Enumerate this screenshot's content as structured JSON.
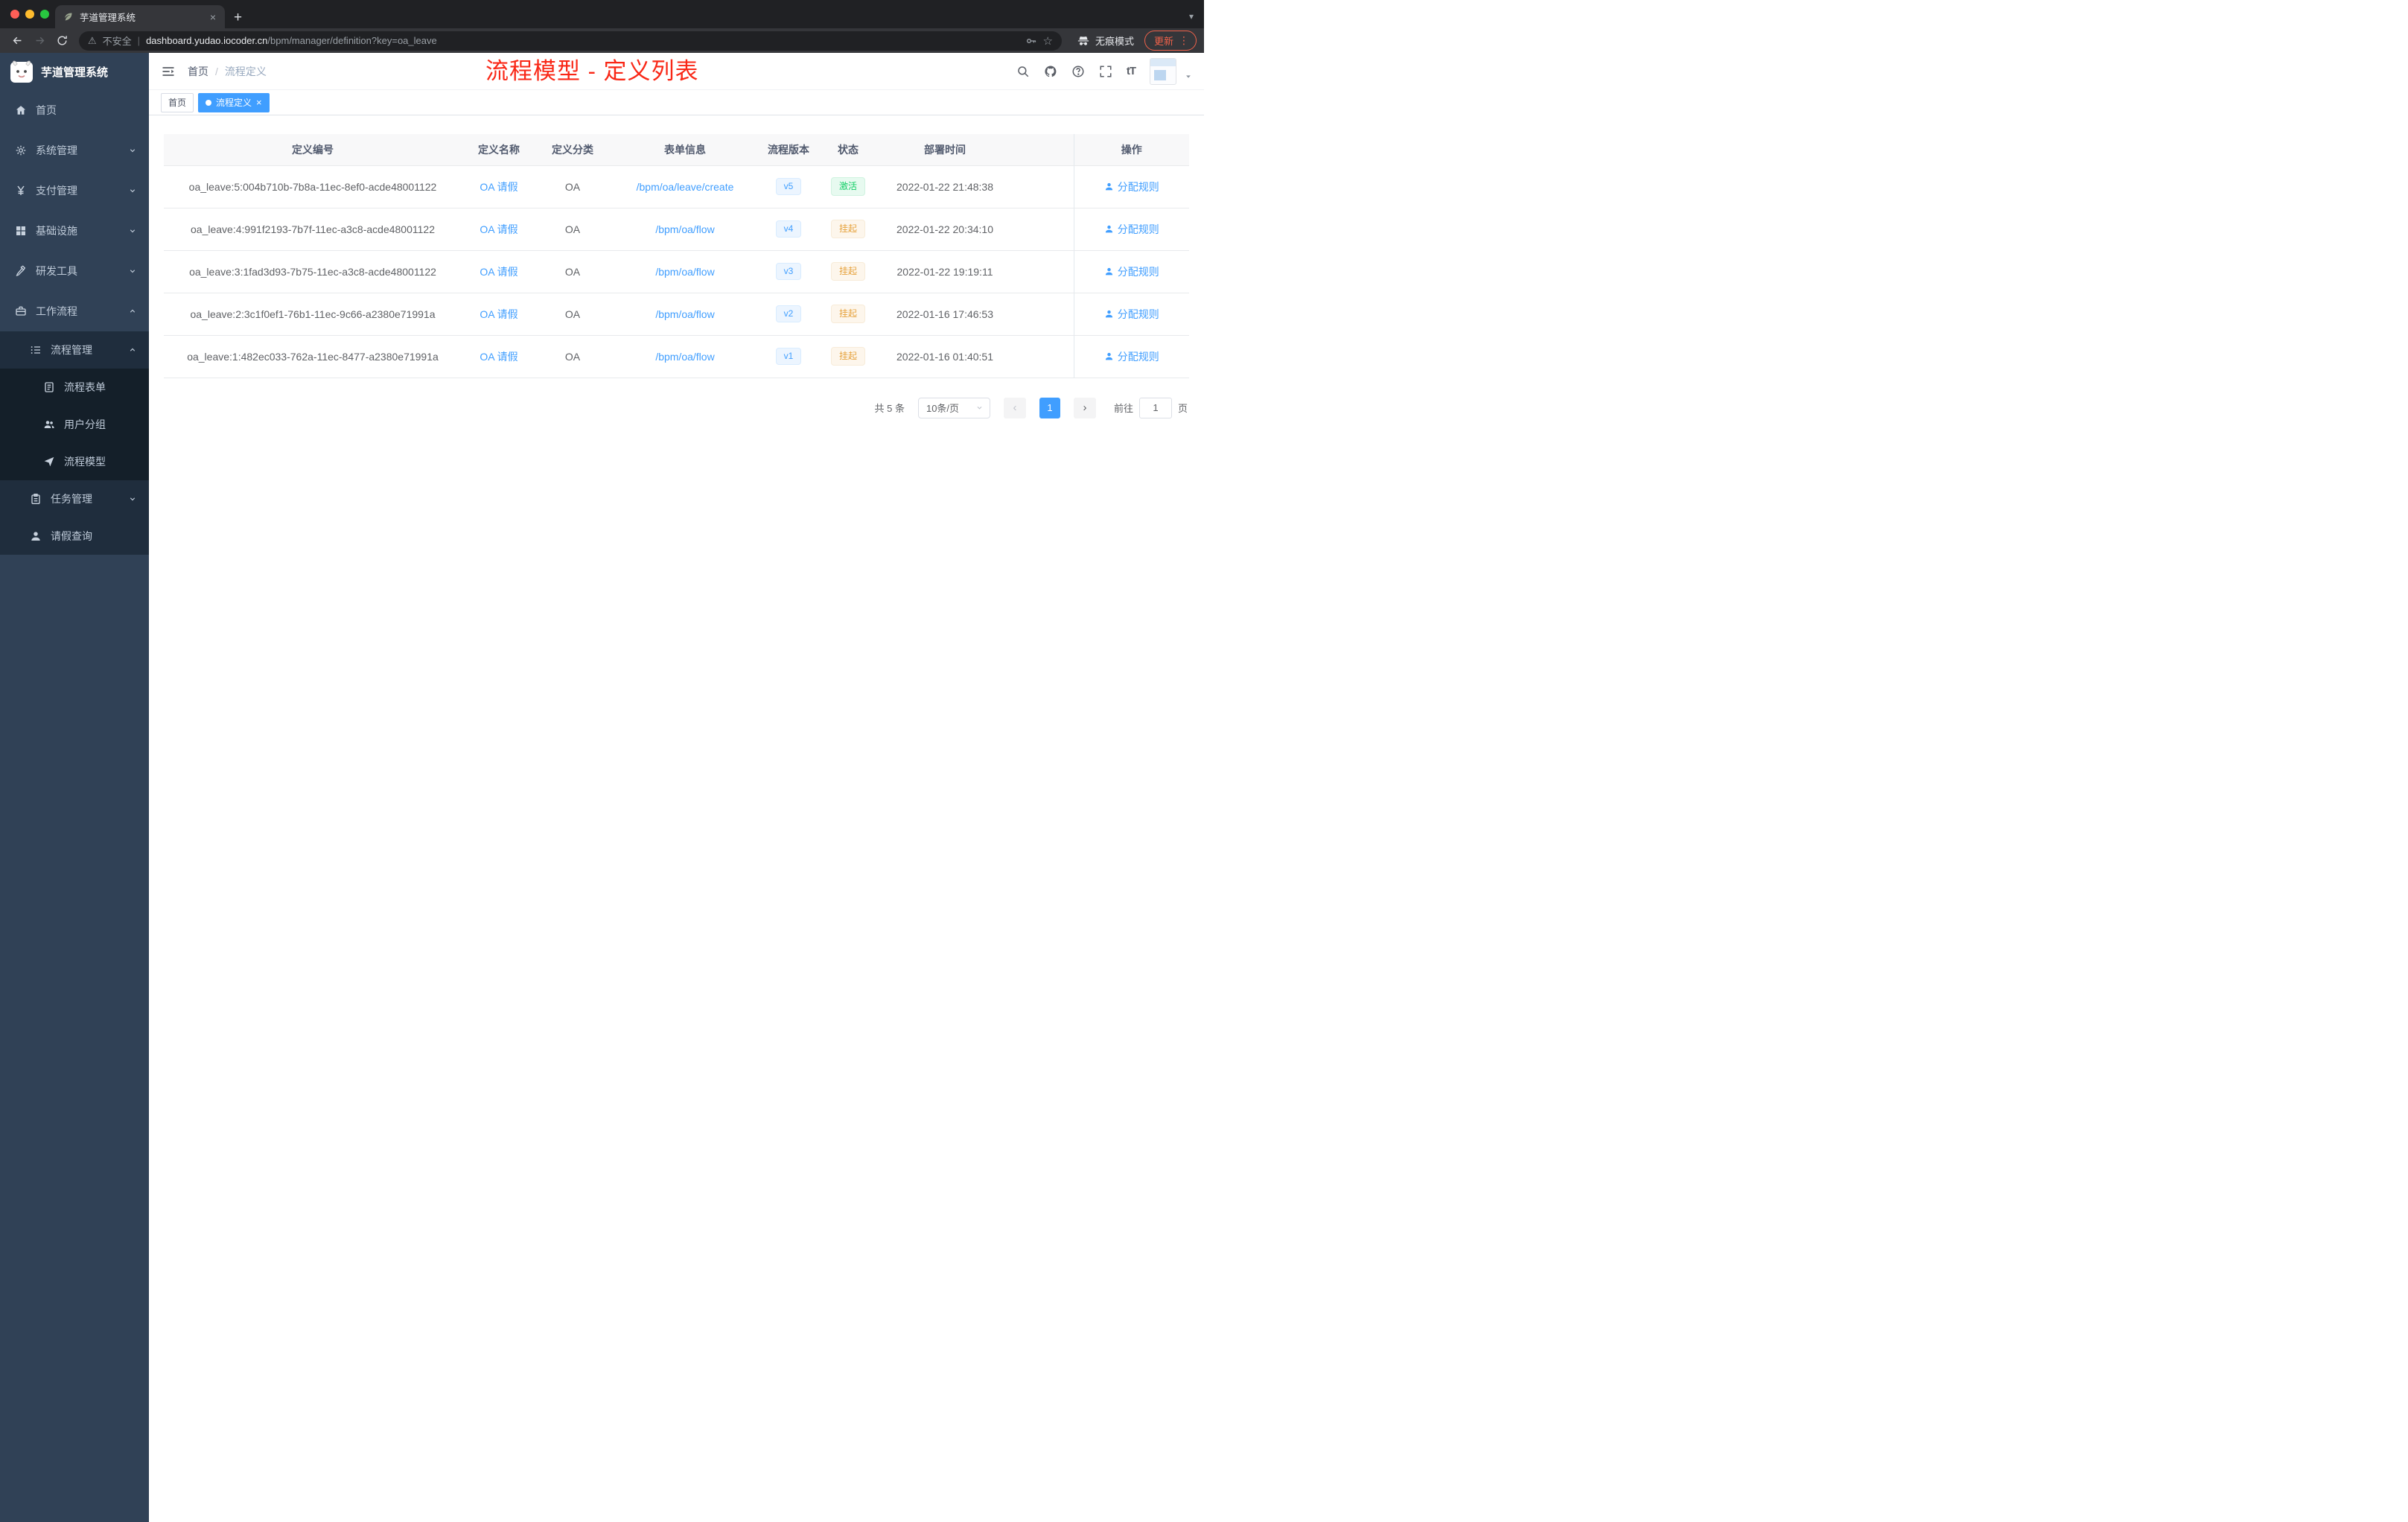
{
  "browser": {
    "tab_title": "芋道管理系统",
    "close_tab": "×",
    "new_tab": "+",
    "security_label": "不安全",
    "url_domain": "dashboard.yudao.iocoder.cn",
    "url_path": "/bpm/manager/definition?key=oa_leave",
    "incognito_label": "无痕模式",
    "update_label": "更新"
  },
  "sidebar": {
    "logo_title": "芋道管理系统",
    "items": [
      {
        "key": "home",
        "label": "首页",
        "icon": "home-icon",
        "level": 1
      },
      {
        "key": "system",
        "label": "系统管理",
        "icon": "gear-icon",
        "level": 1,
        "arrow": "down"
      },
      {
        "key": "payment",
        "label": "支付管理",
        "icon": "yen-icon",
        "level": 1,
        "arrow": "down"
      },
      {
        "key": "infrastructure",
        "label": "基础设施",
        "icon": "infrastructure-icon",
        "level": 1,
        "arrow": "down"
      },
      {
        "key": "devtools",
        "label": "研发工具",
        "icon": "tools-icon",
        "level": 1,
        "arrow": "down"
      },
      {
        "key": "workflow",
        "label": "工作流程",
        "icon": "workflow-icon",
        "level": 1,
        "arrow": "up"
      },
      {
        "key": "process-management",
        "label": "流程管理",
        "icon": "process-management-icon",
        "level": 2,
        "arrow": "up"
      },
      {
        "key": "process-form",
        "label": "流程表单",
        "icon": "form-icon",
        "level": 3
      },
      {
        "key": "user-group",
        "label": "用户分组",
        "icon": "user-group-icon",
        "level": 3
      },
      {
        "key": "process-model",
        "label": "流程模型",
        "icon": "send-icon",
        "level": 3
      },
      {
        "key": "task-management",
        "label": "任务管理",
        "icon": "task-icon",
        "level": 2,
        "arrow": "down"
      },
      {
        "key": "leave-query",
        "label": "请假查询",
        "icon": "user-icon",
        "level": 2
      }
    ]
  },
  "header": {
    "breadcrumb_home": "首页",
    "breadcrumb_sep": "/",
    "breadcrumb_current": "流程定义",
    "annotation": "流程模型 - 定义列表"
  },
  "tags": [
    {
      "label": "首页",
      "active": false,
      "closable": false
    },
    {
      "label": "流程定义",
      "active": true,
      "closable": true
    }
  ],
  "table": {
    "columns": [
      "定义编号",
      "定义名称",
      "定义分类",
      "表单信息",
      "流程版本",
      "状态",
      "部署时间",
      "操作"
    ],
    "rows": [
      {
        "id": "oa_leave:5:004b710b-7b8a-11ec-8ef0-acde48001122",
        "name": "OA 请假",
        "category": "OA",
        "form": "/bpm/oa/leave/create",
        "version": "v5",
        "status": "激活",
        "status_type": "success",
        "time": "2022-01-22 21:48:38",
        "action": "分配规则"
      },
      {
        "id": "oa_leave:4:991f2193-7b7f-11ec-a3c8-acde48001122",
        "name": "OA 请假",
        "category": "OA",
        "form": "/bpm/oa/flow",
        "version": "v4",
        "status": "挂起",
        "status_type": "warning",
        "time": "2022-01-22 20:34:10",
        "action": "分配规则"
      },
      {
        "id": "oa_leave:3:1fad3d93-7b75-11ec-a3c8-acde48001122",
        "name": "OA 请假",
        "category": "OA",
        "form": "/bpm/oa/flow",
        "version": "v3",
        "status": "挂起",
        "status_type": "warning",
        "time": "2022-01-22 19:19:11",
        "action": "分配规则"
      },
      {
        "id": "oa_leave:2:3c1f0ef1-76b1-11ec-9c66-a2380e71991a",
        "name": "OA 请假",
        "category": "OA",
        "form": "/bpm/oa/flow",
        "version": "v2",
        "status": "挂起",
        "status_type": "warning",
        "time": "2022-01-16 17:46:53",
        "action": "分配规则"
      },
      {
        "id": "oa_leave:1:482ec033-762a-11ec-8477-a2380e71991a",
        "name": "OA 请假",
        "category": "OA",
        "form": "/bpm/oa/flow",
        "version": "v1",
        "status": "挂起",
        "status_type": "warning",
        "time": "2022-01-16 01:40:51",
        "action": "分配规则"
      }
    ]
  },
  "pagination": {
    "total": "共 5 条",
    "page_size": "10条/页",
    "prev": "‹",
    "current_page": "1",
    "next": "›",
    "goto_label": "前往",
    "goto_value": "1",
    "goto_unit": "页"
  },
  "colors": {
    "primary": "#409EFF",
    "sidebar_bg": "#304156",
    "submenu_bg": "#1f2d3d",
    "success_text": "#13ce66",
    "success_bg": "#e7faf0",
    "warning_text": "#e6a23c",
    "warning_bg": "#fdf6ec",
    "annotation_red": "#f92716",
    "tag_active_bg": "#409EFF"
  }
}
